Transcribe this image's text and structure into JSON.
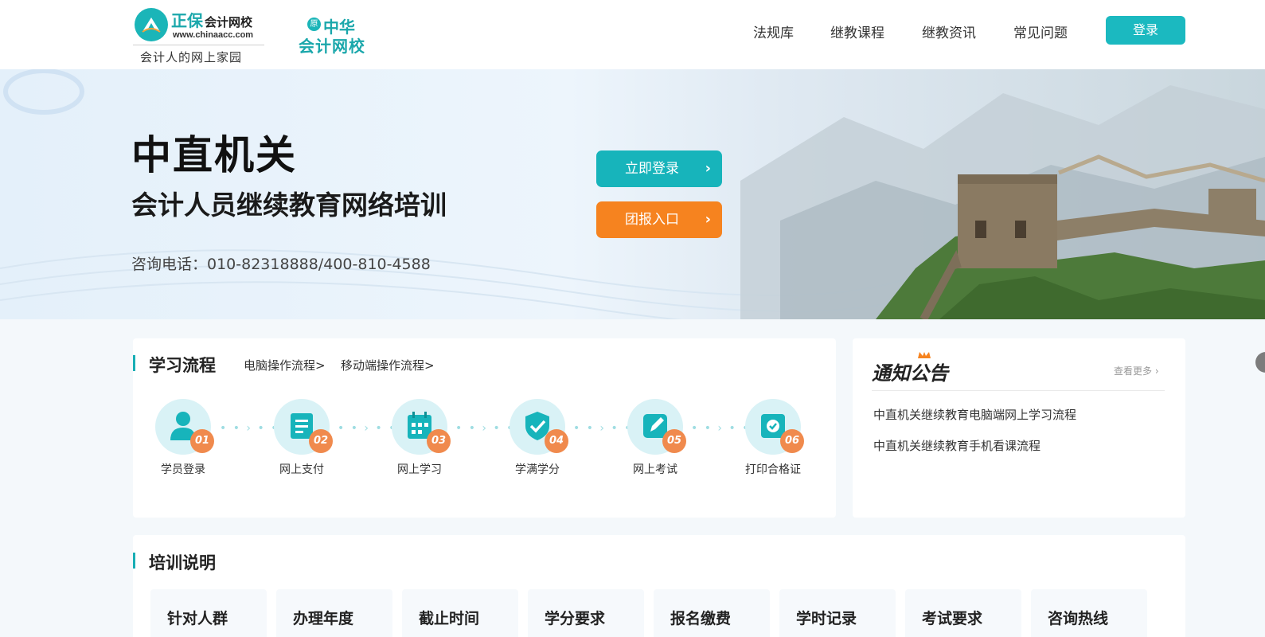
{
  "header": {
    "logo": {
      "brand": "正保",
      "brand_suffix": "会计网校",
      "url": "www.chinaacc.com",
      "slogan": "会计人的网上家园"
    },
    "logo2": {
      "badge": "原",
      "line1": "中华",
      "line2": "会计网校"
    },
    "nav": [
      "法规库",
      "继教课程",
      "继教资讯",
      "常见问题"
    ],
    "login_label": "登录"
  },
  "banner": {
    "title": "中直机关",
    "subtitle": "会计人员继续教育网络培训",
    "phone": "咨询电话：010-82318888/400-810-4588",
    "login_now": "立即登录",
    "group_entry": "团报入口",
    "chevron": "›"
  },
  "process": {
    "title": "学习流程",
    "links": [
      "电脑操作流程>",
      "移动端操作流程>"
    ],
    "steps": [
      {
        "num": "01",
        "label": "学员登录",
        "icon": "user-icon"
      },
      {
        "num": "02",
        "label": "网上支付",
        "icon": "payment-icon"
      },
      {
        "num": "03",
        "label": "网上学习",
        "icon": "calendar-icon"
      },
      {
        "num": "04",
        "label": "学满学分",
        "icon": "shield-check-icon"
      },
      {
        "num": "05",
        "label": "网上考试",
        "icon": "exam-edit-icon"
      },
      {
        "num": "06",
        "label": "打印合格证",
        "icon": "certificate-icon"
      }
    ],
    "connector": "• • › • •"
  },
  "notice": {
    "title": "通知公告",
    "more": "查看更多",
    "more_chevron": "›",
    "items": [
      "中直机关继续教育电脑端网上学习流程",
      "中直机关继续教育手机看课流程"
    ]
  },
  "training": {
    "title": "培训说明",
    "cards": [
      "针对人群",
      "办理年度",
      "截止时间",
      "学分要求",
      "报名缴费",
      "学时记录",
      "考试要求",
      "咨询热线"
    ]
  },
  "colors": {
    "teal": "#17b4bb",
    "orange": "#f6831f",
    "badge_orange": "#f08a4d"
  }
}
